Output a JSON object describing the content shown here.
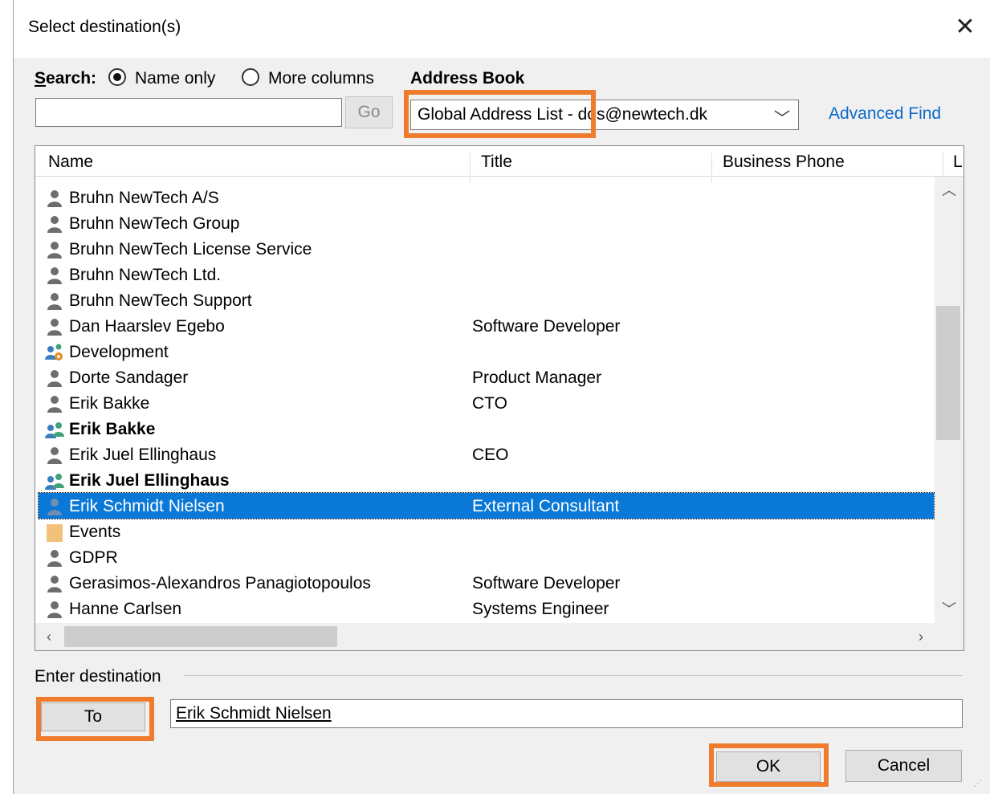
{
  "dialog": {
    "title": "Select destination(s)",
    "close_glyph": "✕"
  },
  "search": {
    "label": "Search:",
    "name_only": "Name only",
    "more_columns": "More columns",
    "selected_option": "Name only",
    "input_value": "",
    "go_label": "Go"
  },
  "address_book": {
    "label": "Address Book",
    "selected": "Global Address List - dos@newtech.dk",
    "advanced_find": "Advanced Find"
  },
  "columns": [
    "Name",
    "Title",
    "Business Phone",
    "L"
  ],
  "rows": [
    {
      "name": "Bruhn NewTech A/S",
      "title": "",
      "icon": "contact-icon",
      "bold": false,
      "selected": false
    },
    {
      "name": "Bruhn NewTech Group",
      "title": "",
      "icon": "contact-icon",
      "bold": false,
      "selected": false
    },
    {
      "name": "Bruhn NewTech License Service",
      "title": "",
      "icon": "contact-icon",
      "bold": false,
      "selected": false
    },
    {
      "name": "Bruhn NewTech Ltd.",
      "title": "",
      "icon": "contact-icon",
      "bold": false,
      "selected": false
    },
    {
      "name": "Bruhn NewTech Support",
      "title": "",
      "icon": "contact-icon",
      "bold": false,
      "selected": false
    },
    {
      "name": "Dan Haarslev Egebo",
      "title": "Software Developer",
      "icon": "contact-icon",
      "bold": false,
      "selected": false
    },
    {
      "name": "Development",
      "title": "",
      "icon": "dynamic-group-icon",
      "bold": false,
      "selected": false
    },
    {
      "name": "Dorte Sandager",
      "title": "Product Manager",
      "icon": "contact-icon",
      "bold": false,
      "selected": false
    },
    {
      "name": "Erik Bakke",
      "title": "CTO",
      "icon": "contact-icon",
      "bold": false,
      "selected": false
    },
    {
      "name": "Erik Bakke",
      "title": "",
      "icon": "group-icon",
      "bold": true,
      "selected": false
    },
    {
      "name": "Erik Juel Ellinghaus",
      "title": "CEO",
      "icon": "contact-icon",
      "bold": false,
      "selected": false
    },
    {
      "name": "Erik Juel Ellinghaus",
      "title": "",
      "icon": "group-icon",
      "bold": true,
      "selected": false
    },
    {
      "name": "Erik Schmidt Nielsen",
      "title": "External Consultant",
      "icon": "contact-icon",
      "bold": false,
      "selected": true
    },
    {
      "name": "Events",
      "title": "",
      "icon": "folder-icon",
      "bold": false,
      "selected": false
    },
    {
      "name": "GDPR",
      "title": "",
      "icon": "contact-icon",
      "bold": false,
      "selected": false
    },
    {
      "name": "Gerasimos-Alexandros Panagiotopoulos",
      "title": "Software Developer",
      "icon": "contact-icon",
      "bold": false,
      "selected": false
    },
    {
      "name": "Hanne Carlsen",
      "title": "Systems Engineer",
      "icon": "contact-icon",
      "bold": false,
      "selected": false
    }
  ],
  "destination": {
    "label": "Enter destination",
    "to_label": "To",
    "value": "Erik Schmidt Nielsen"
  },
  "buttons": {
    "ok": "OK",
    "cancel": "Cancel"
  },
  "colors": {
    "highlight": "#ee7c2c",
    "selection": "#0a78d7",
    "link": "#0b6ac9"
  }
}
